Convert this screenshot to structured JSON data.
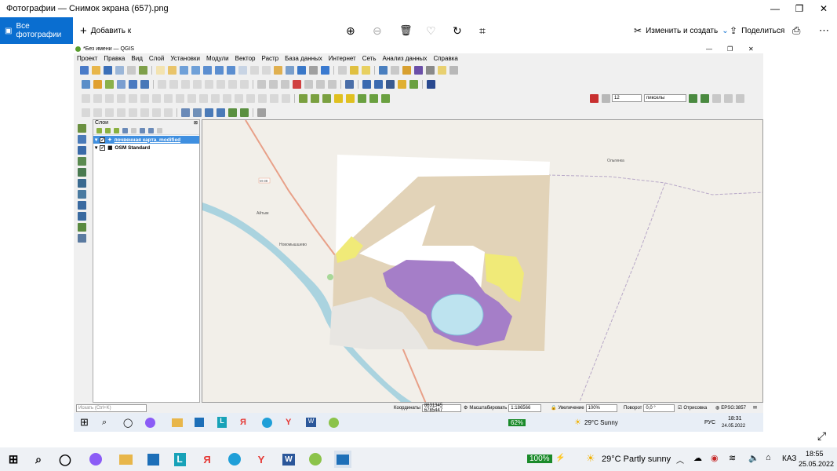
{
  "photos": {
    "title": "Фотографии — Снимок экрана (657).png",
    "all_photos": "Все фотографии",
    "add_to": "Добавить к",
    "edit_create": "Изменить и создать",
    "share": "Поделиться"
  },
  "qgis": {
    "title": "*Без имени — QGIS",
    "menu": [
      "Проект",
      "Правка",
      "Вид",
      "Слой",
      "Установки",
      "Модули",
      "Вектор",
      "Растр",
      "База данных",
      "Интернет",
      "Сеть",
      "Анализ данных",
      "Справка"
    ],
    "size_value": "12",
    "size_unit": "пикселы",
    "layers_title": "Слои",
    "layers": [
      {
        "name": "почвенная карта_modified"
      },
      {
        "name": "OSM Standard"
      }
    ],
    "map_labels": {
      "road": "М-38",
      "town1": "Айтым",
      "town2": "Новомышшево",
      "town3": "Ольгинка"
    },
    "status": {
      "search_placeholder": "Искать (Ctrl+K)",
      "coord_label": "Координаты",
      "coord_value": "8631345 6785447",
      "scale_label": "Масштабировать",
      "scale_value": "1:186566",
      "magnifier_label": "Увеличение",
      "magnifier_value": "100%",
      "rotation_label": "Поворот",
      "rotation_value": "0,0 °",
      "render_label": "Отрисовка",
      "crs": "EPSG:3857"
    },
    "inner_taskbar": {
      "battery": "62%",
      "weather": "29°C  Sunny",
      "lang": "РУС",
      "time": "18:31",
      "date": "24.05.2022"
    }
  },
  "taskbar": {
    "battery": "100%",
    "weather": "29°C  Partly sunny",
    "lang": "КАЗ",
    "time": "18:55",
    "date": "25.05.2022"
  }
}
